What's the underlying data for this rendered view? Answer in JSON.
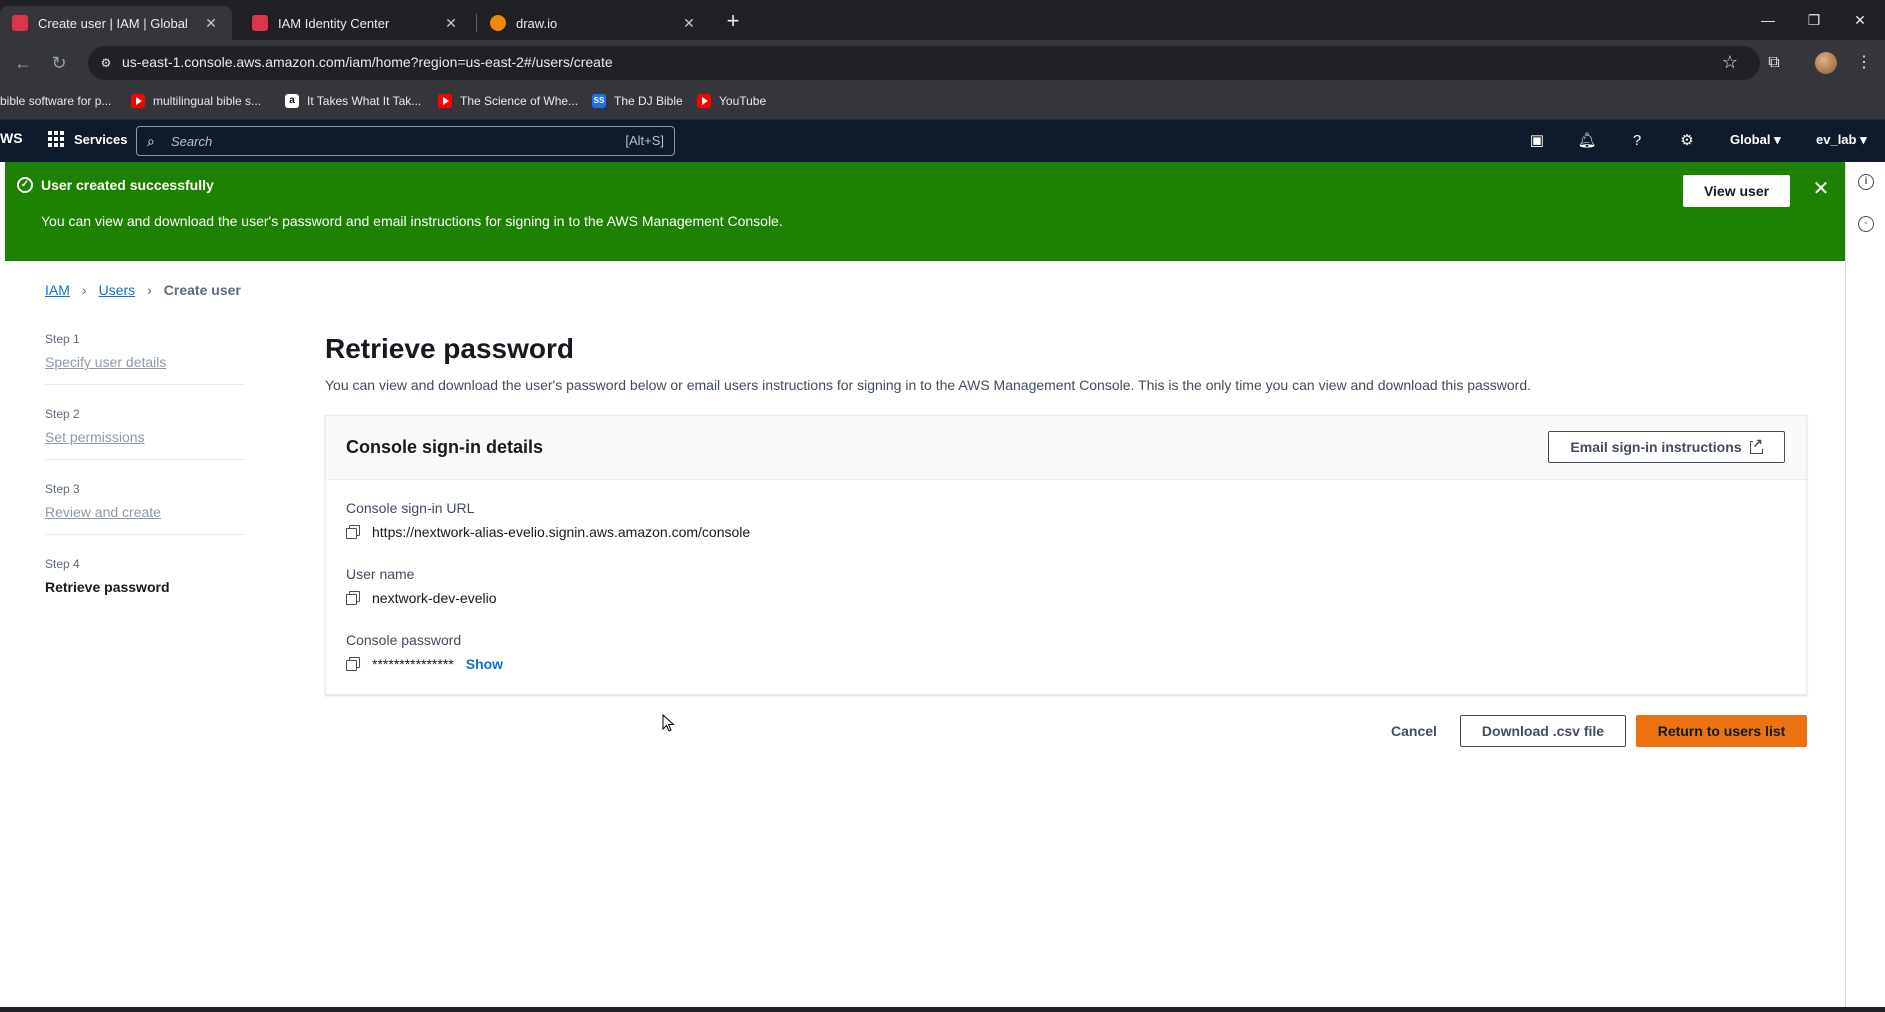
{
  "browser": {
    "tabs": [
      {
        "title": "Create user | IAM | Global",
        "active": true,
        "favicon_color": "#dd344c"
      },
      {
        "title": "IAM Identity Center",
        "active": false,
        "favicon_color": "#dd344c"
      },
      {
        "title": "draw.io",
        "active": false,
        "favicon_color": "#f08705"
      }
    ],
    "new_tab_label": "+",
    "url": "us-east-1.console.aws.amazon.com/iam/home?region=us-east-2#/users/create",
    "bookmarks": [
      {
        "label": "bible software for p...",
        "icon": "none"
      },
      {
        "label": "multilingual bible s...",
        "icon": "youtube-icon"
      },
      {
        "label": "It Takes What It Tak...",
        "icon": "amazon-icon"
      },
      {
        "label": "The Science of Whe...",
        "icon": "youtube-icon"
      },
      {
        "label": "The DJ Bible",
        "icon": "dj-bible-icon"
      },
      {
        "label": "YouTube",
        "icon": "youtube-icon"
      }
    ]
  },
  "aws_nav": {
    "logo_text": "WS",
    "services_label": "Services",
    "search_placeholder": "Search",
    "search_shortcut": "[Alt+S]",
    "region_label": "Global",
    "account_label": "ev_lab"
  },
  "flash": {
    "title": "User created successfully",
    "message": "You can view and download the user's password and email instructions for signing in to the AWS Management Console.",
    "action_label": "View user",
    "color": "#1d8102"
  },
  "breadcrumb": {
    "items": [
      "IAM",
      "Users"
    ],
    "current": "Create user"
  },
  "steps": [
    {
      "number": "Step 1",
      "label": "Specify user details",
      "active": false
    },
    {
      "number": "Step 2",
      "label": "Set permissions",
      "active": false
    },
    {
      "number": "Step 3",
      "label": "Review and create",
      "active": false
    },
    {
      "number": "Step 4",
      "label": "Retrieve password",
      "active": true
    }
  ],
  "main": {
    "title": "Retrieve password",
    "description": "You can view and download the user's password below or email users instructions for signing in to the AWS Management Console. This is the only time you can view and download this password.",
    "card": {
      "title": "Console sign-in details",
      "email_button_label": "Email sign-in instructions",
      "fields": [
        {
          "label": "Console sign-in URL",
          "value": "https://nextwork-alias-evelio.signin.aws.amazon.com/console"
        },
        {
          "label": "User name",
          "value": "nextwork-dev-evelio"
        },
        {
          "label": "Console password",
          "value": "***************",
          "show_label": "Show"
        }
      ]
    },
    "actions": {
      "cancel_label": "Cancel",
      "download_label": "Download .csv file",
      "return_label": "Return to users list",
      "primary_color": "#ec7211"
    }
  }
}
